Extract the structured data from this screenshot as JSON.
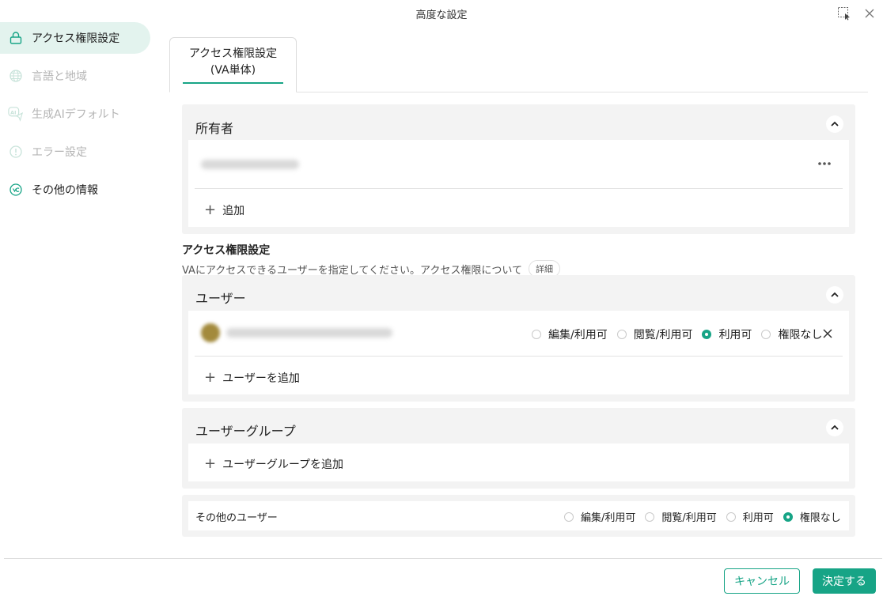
{
  "window": {
    "title": "高度な設定"
  },
  "sidebar": {
    "items": [
      {
        "label": "アクセス権限設定",
        "icon": "lock-icon"
      },
      {
        "label": "言語と地域",
        "icon": "globe-icon"
      },
      {
        "label": "生成AIデフォルト",
        "icon": "ai-icon"
      },
      {
        "label": "エラー設定",
        "icon": "alert-icon"
      },
      {
        "label": "その他の情報",
        "icon": "info-icon"
      }
    ]
  },
  "tabs": [
    {
      "line1": "アクセス権限設定",
      "line2": "(VA単体)"
    }
  ],
  "owner": {
    "title": "所有者",
    "add_label": "追加"
  },
  "access": {
    "title": "アクセス権限設定",
    "description": "VAにアクセスできるユーザーを指定してください。アクセス権限について",
    "detail_label": "詳細"
  },
  "users": {
    "title": "ユーザー",
    "options": [
      "編集/利用可",
      "閲覧/利用可",
      "利用可",
      "権限なし"
    ],
    "selected": "利用可",
    "add_label": "ユーザーを追加"
  },
  "groups": {
    "title": "ユーザーグループ",
    "add_label": "ユーザーグループを追加"
  },
  "others": {
    "label": "その他のユーザー",
    "options": [
      "編集/利用可",
      "閲覧/利用可",
      "利用可",
      "権限なし"
    ],
    "selected": "権限なし"
  },
  "footer": {
    "cancel_label": "キャンセル",
    "ok_label": "決定する"
  },
  "colors": {
    "accent": "#17a486",
    "active_bg": "#e3f3ee",
    "panel_bg": "#f3f3f3"
  }
}
